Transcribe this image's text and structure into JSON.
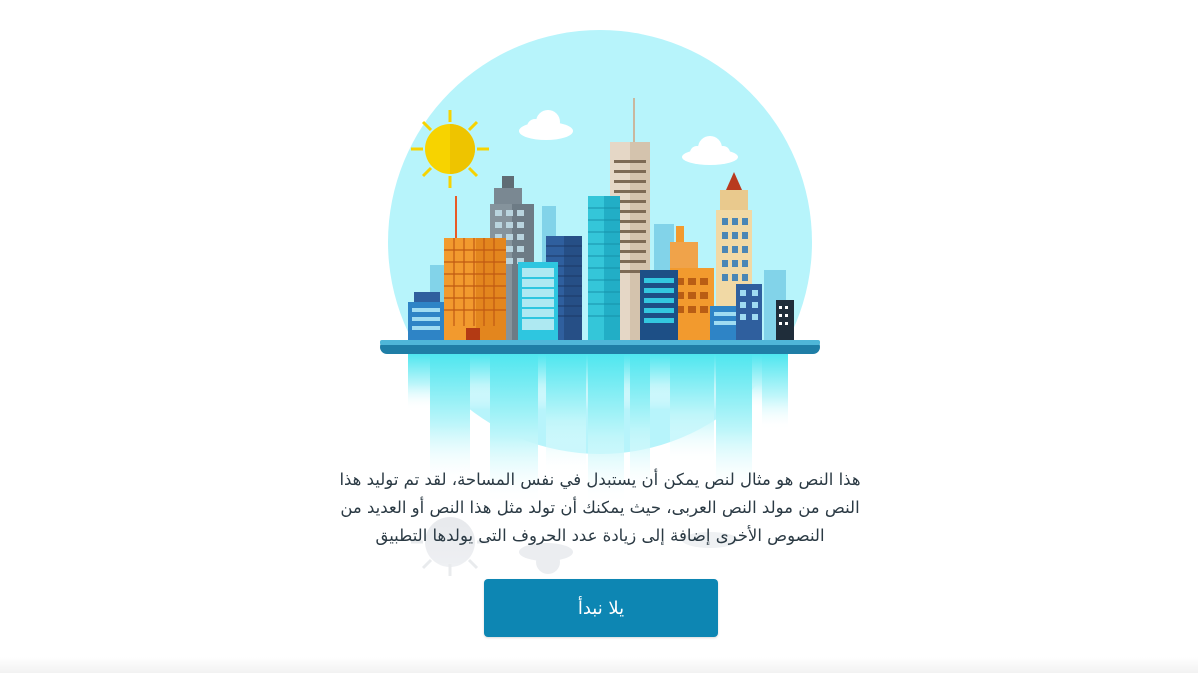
{
  "onboarding": {
    "illustration_icon": "city-skyline-icon",
    "description_lines": [
      "هذا النص هو مثال لنص يمكن أن يستبدل في نفس المساحة، لقد تم توليد هذا",
      "النص من مولد النص العربى، حيث يمكنك أن تولد مثل هذا النص أو العديد من",
      "النصوص الأخرى إضافة إلى زيادة عدد الحروف التى يولدها التطبيق"
    ],
    "start_button_label": "يلا نبدأ"
  },
  "colors": {
    "accent": "#0d86b3",
    "sky": "#b7f4fb",
    "sun": "#f7d300",
    "text": "#2b3a44"
  }
}
